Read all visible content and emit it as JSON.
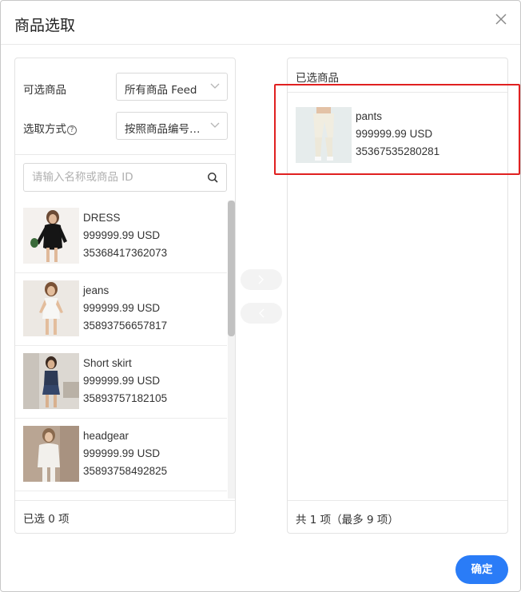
{
  "dialog": {
    "title": "商品选取",
    "confirm_label": "确定"
  },
  "filters": {
    "source_label": "可选商品",
    "source_value": "所有商品 Feed",
    "method_label": "选取方式",
    "method_help": "?",
    "method_value": "按照商品编号…"
  },
  "search": {
    "placeholder": "请输入名称或商品 ID",
    "value": ""
  },
  "available": {
    "items": [
      {
        "name": "DRESS",
        "price": "999999.99 USD",
        "id": "35368417362073",
        "image": "dress-photo"
      },
      {
        "name": "jeans",
        "price": "999999.99 USD",
        "id": "35893756657817",
        "image": "white-dress-photo"
      },
      {
        "name": "Short skirt",
        "price": "999999.99 USD",
        "id": "35893757182105",
        "image": "denim-outfit-photo"
      },
      {
        "name": "headgear",
        "price": "999999.99 USD",
        "id": "35893758492825",
        "image": "headgear-photo"
      }
    ],
    "footer": "已选 0 项"
  },
  "selected": {
    "title": "已选商品",
    "items": [
      {
        "name": "pants",
        "price": "999999.99 USD",
        "id": "35367535280281",
        "image": "pants-photo"
      }
    ],
    "footer": "共 1 项（最多 9 项）"
  },
  "colors": {
    "accent": "#2a7cf7",
    "highlight": "#e02020"
  },
  "icons": {
    "close": "close-icon",
    "search": "search-icon",
    "move_right": "chevron-right-icon",
    "move_left": "chevron-left-icon"
  }
}
